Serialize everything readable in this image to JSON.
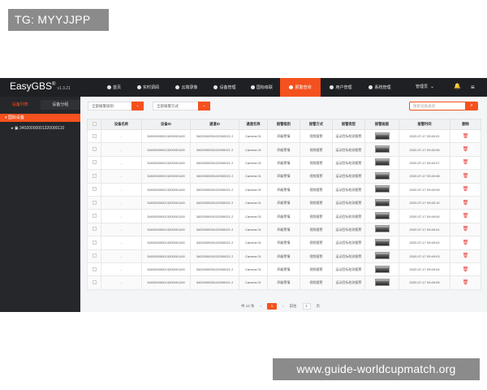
{
  "watermarks": {
    "top": "TG: MYYJJPP",
    "bottom": "www.guide-worldcupmatch.org"
  },
  "brand": {
    "name": "EasyGBS",
    "reg": "®",
    "version": "v1.3.21"
  },
  "nav": [
    {
      "label": "首页",
      "icon": "home-icon",
      "active": false
    },
    {
      "label": "实时调阅",
      "icon": "play-icon",
      "active": false
    },
    {
      "label": "云端录像",
      "icon": "video-icon",
      "active": false
    },
    {
      "label": "设备管理",
      "icon": "device-icon",
      "active": false
    },
    {
      "label": "国标级联",
      "icon": "cascade-icon",
      "active": false
    },
    {
      "label": "报警查询",
      "icon": "alarm-icon",
      "active": true
    },
    {
      "label": "用户管理",
      "icon": "user-icon",
      "active": false
    },
    {
      "label": "系统管理",
      "icon": "gear-icon",
      "active": false
    }
  ],
  "user": {
    "name": "管理员",
    "chevron": "⌄"
  },
  "bell": "🔔",
  "menu": "≡",
  "sidebar": {
    "tabs": [
      "设备列表",
      "设备分组"
    ],
    "root": "国标设备",
    "child": "34020000001320000110"
  },
  "filters": {
    "alarm_level": "全部报警级别",
    "alarm_method": "全部报警方式",
    "search_placeholder": "搜索设备通道"
  },
  "table": {
    "headers": [
      "设备名称",
      "设备ID",
      "通道ID",
      "通道名称",
      "报警级别",
      "报警方式",
      "报警类型",
      "报警画面",
      "报警时间",
      "删除"
    ],
    "rows": [
      {
        "name": "-",
        "device_id": "340200000013200001100",
        "channel_id": "3402000000132000021 2",
        "channel_name": "Camera 01",
        "level": "四级警情",
        "method": "视频报警",
        "type": "运动目标检测报警",
        "time": "2020-07-17 09:40:01"
      },
      {
        "name": "-",
        "device_id": "340200000013200001100",
        "channel_id": "3402000000132000021 2",
        "channel_name": "Camera 01",
        "level": "四级警情",
        "method": "视频报警",
        "type": "运动目标检测报警",
        "time": "2020-07-17 09:40:06"
      },
      {
        "name": "-",
        "device_id": "340200000013200001100",
        "channel_id": "3402000000132000021 2",
        "channel_name": "Camera 01",
        "level": "四级警情",
        "method": "视频报警",
        "type": "运动目标检测报警",
        "time": "2020-07-17 09:40:07"
      },
      {
        "name": "-",
        "device_id": "340200000013200001100",
        "channel_id": "3402000000132000021 2",
        "channel_name": "Camera 01",
        "level": "四级警情",
        "method": "视频报警",
        "type": "运动目标检测报警",
        "time": "2020-07-17 09:40:08"
      },
      {
        "name": "-",
        "device_id": "340200000013200001100",
        "channel_id": "3402000000132000021 2",
        "channel_name": "Camera 01",
        "level": "四级警情",
        "method": "视频报警",
        "type": "运动目标检测报警",
        "time": "2020-07-17 09:40:09"
      },
      {
        "name": "-",
        "device_id": "340200000013200001100",
        "channel_id": "3402000000132000021 2",
        "channel_name": "Camera 01",
        "level": "四级警情",
        "method": "视频报警",
        "type": "运动目标检测报警",
        "time": "2020-07-17 09:40:10"
      },
      {
        "name": "-",
        "device_id": "340200000013200001100",
        "channel_id": "3402000000132000021 2",
        "channel_name": "Camera 01",
        "level": "四级警情",
        "method": "视频报警",
        "type": "运动目标检测报警",
        "time": "2020-07-17 09:49:00"
      },
      {
        "name": "-",
        "device_id": "340200000013200001100",
        "channel_id": "3402000000132000021 2",
        "channel_name": "Camera 01",
        "level": "四级警情",
        "method": "视频报警",
        "type": "运动目标检测报警",
        "time": "2020-07-17 09:49:01"
      },
      {
        "name": "-",
        "device_id": "340200000013200001100",
        "channel_id": "3402000000132000021 2",
        "channel_name": "Camera 01",
        "level": "四级警情",
        "method": "视频报警",
        "type": "运动目标检测报警",
        "time": "2020-07-17 09:49:02"
      },
      {
        "name": "-",
        "device_id": "340200000013200001100",
        "channel_id": "3402000000132000021 2",
        "channel_name": "Camera 01",
        "level": "四级警情",
        "method": "视频报警",
        "type": "运动目标检测报警",
        "time": "2020-07-17 09:49:03"
      },
      {
        "name": "-",
        "device_id": "340200000013200001100",
        "channel_id": "3402000000132000021 2",
        "channel_name": "Camera 01",
        "level": "四级警情",
        "method": "视频报警",
        "type": "运动目标检测报警",
        "time": "2020-07-17 09:49:04"
      },
      {
        "name": "-",
        "device_id": "340200000013200001100",
        "channel_id": "3402000000132000021 2",
        "channel_name": "Camera 01",
        "level": "四级警情",
        "method": "视频报警",
        "type": "运动目标检测报警",
        "time": "2020-07-17 09:49:05"
      }
    ]
  },
  "pager": {
    "total": "共 12 条",
    "prev": "‹",
    "current": "1",
    "next": "›",
    "goto": "前往",
    "page": "1",
    "unit": "页"
  },
  "colors": {
    "accent": "#f4511e",
    "topbar": "#1f2023",
    "sidebar": "#25272b",
    "delete": "#e53935"
  }
}
